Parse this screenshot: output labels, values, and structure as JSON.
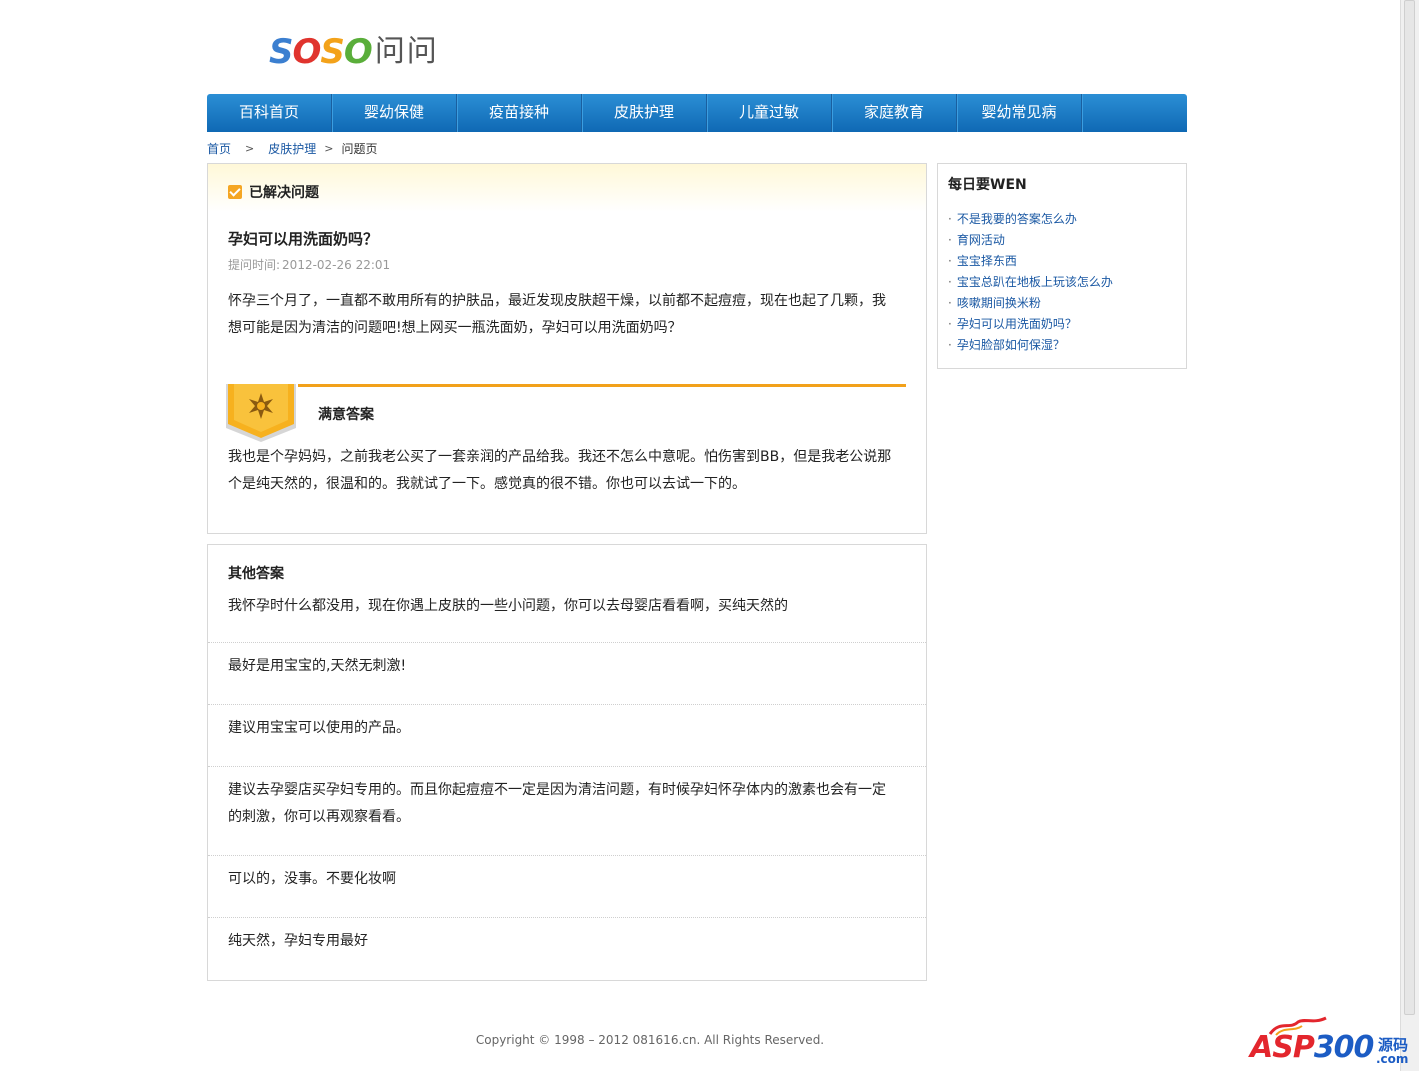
{
  "logo": {
    "letters": [
      "S",
      "O",
      "S",
      "O"
    ],
    "suffix": "问问"
  },
  "nav": [
    {
      "label": "百科首页"
    },
    {
      "label": "婴幼保健"
    },
    {
      "label": "疫苗接种"
    },
    {
      "label": "皮肤护理"
    },
    {
      "label": "儿童过敏"
    },
    {
      "label": "家庭教育"
    },
    {
      "label": "婴幼常见病"
    }
  ],
  "breadcrumb": {
    "home": "首页",
    "category": "皮肤护理",
    "current": "问题页",
    "sep_glyph": ">"
  },
  "question": {
    "status": "已解决问题",
    "title": "孕妇可以用洗面奶吗？",
    "time_label": "提问时间:",
    "time": "2012-02-26 22:01",
    "body": "怀孕三个月了，一直都不敢用所有的护肤品，最近发现皮肤超干燥，以前都不起痘痘，现在也起了几颗，我想可能是因为清洁的问题吧!想上网买一瓶洗面奶，孕妇可以用洗面奶吗？"
  },
  "best_answer": {
    "title": "满意答案",
    "body": "我也是个孕妈妈，之前我老公买了一套亲润的产品给我。我还不怎么中意呢。怕伤害到BB，但是我老公说那个是纯天然的，很温和的。我就试了一下。感觉真的很不错。你也可以去试一下的。"
  },
  "other_answers": {
    "title": "其他答案",
    "items": [
      "我怀孕时什么都没用，现在你遇上皮肤的一些小问题，你可以去母婴店看看啊，买纯天然的",
      "最好是用宝宝的,天然无刺激!",
      "建议用宝宝可以使用的产品。",
      "建议去孕婴店买孕妇专用的。而且你起痘痘不一定是因为清洁问题，有时候孕妇怀孕体内的激素也会有一定的刺激，你可以再观察看看。",
      "可以的，没事。不要化妆啊",
      "纯天然，孕妇专用最好"
    ]
  },
  "sidebar": {
    "title": "每日要WEN",
    "bullet": "·",
    "links": [
      "不是我要的答案怎么办",
      "育网活动",
      "宝宝择东西",
      "宝宝总趴在地板上玩该怎么办",
      "咳嗽期间换米粉",
      "孕妇可以用洗面奶吗？",
      "孕妇脸部如何保湿？"
    ]
  },
  "footer": "Copyright © 1998 – 2012  081616.cn.  All Rights Reserved.",
  "watermark": {
    "main_a": "ASP",
    "main_b": "300",
    "tag": "源码",
    "domain": ".com"
  },
  "colors": {
    "nav_blue": "#0f69b4",
    "accent_orange": "#f2a11a",
    "link_blue": "#1a58a3"
  }
}
